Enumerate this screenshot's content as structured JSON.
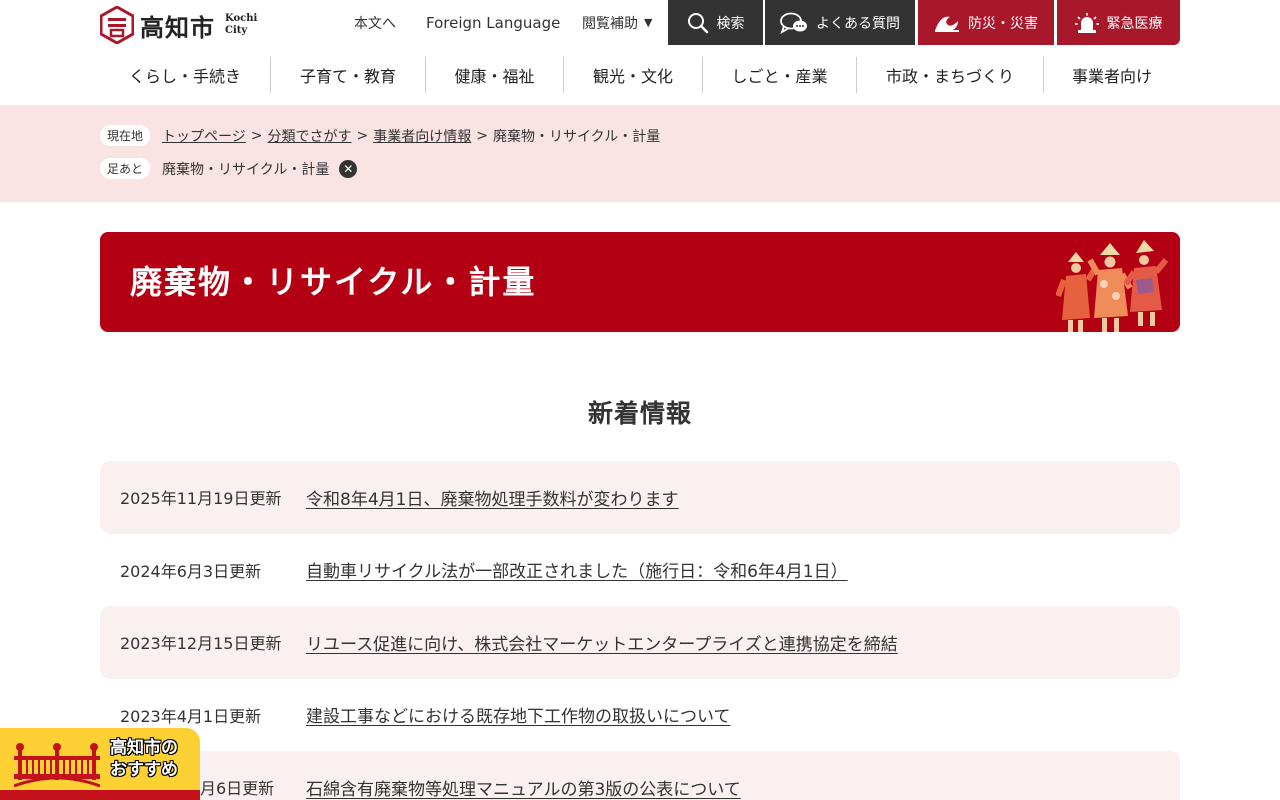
{
  "header": {
    "logo_text": "高知市",
    "logo_sub1": "Kochi",
    "logo_sub2": "City",
    "util_links": {
      "honbun": "本文へ",
      "foreign": "Foreign Language",
      "etsuran": "閲覧補助"
    },
    "buttons": {
      "search": "検索",
      "faq": "よくある質問",
      "bousai": "防災・災害",
      "kinkyu": "緊急医療"
    },
    "colors": {
      "dark": "#333333",
      "red": "#a9172b"
    }
  },
  "gnav": [
    "くらし・手続き",
    "子育て・教育",
    "健康・福祉",
    "観光・文化",
    "しごと・産業",
    "市政・まちづくり",
    "事業者向け"
  ],
  "breadcrumb": {
    "current_label": "現在地",
    "items": [
      "トップページ",
      "分類でさがす",
      "事業者向け情報"
    ],
    "current": "廃棄物・リサイクル・計量",
    "sep": ">",
    "footprint_label": "足あと",
    "footprint_item": "廃棄物・リサイクル・計量"
  },
  "banner": {
    "title": "廃棄物・リサイクル・計量",
    "color": "#b30012"
  },
  "news": {
    "title": "新着情報",
    "items": [
      {
        "date": "2025年11月19日更新",
        "title": "令和8年4月1日、廃棄物処理手数料が変わります"
      },
      {
        "date": "2024年6月3日更新",
        "title": "自動車リサイクル法が一部改正されました（施行日：令和6年4月1日）"
      },
      {
        "date": "2023年12月15日更新",
        "title": "リユース促進に向け、株式会社マーケットエンタープライズと連携協定を締結"
      },
      {
        "date": "2023年4月1日更新",
        "title": "建設工事などにおける既存地下工作物の取扱いについて"
      },
      {
        "date": "月6日更新",
        "title": "石綿含有廃棄物等処理マニュアルの第3版の公表について"
      }
    ]
  },
  "recommend": {
    "line1": "高知市の",
    "line2": "おすすめ"
  }
}
